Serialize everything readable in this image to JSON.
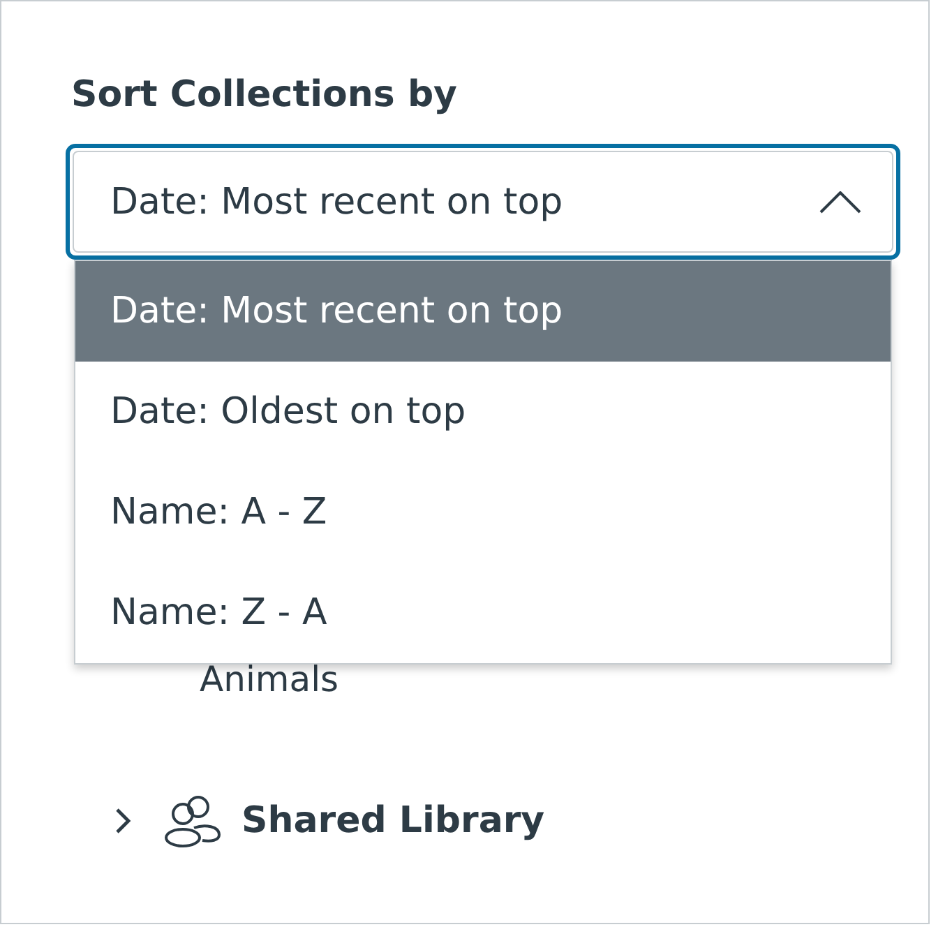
{
  "label": "Sort Collections by",
  "select": {
    "value": "Date: Most recent on top",
    "expanded": true
  },
  "options": [
    {
      "label": "Date: Most recent on top",
      "selected": true
    },
    {
      "label": "Date: Oldest on top",
      "selected": false
    },
    {
      "label": "Name: A - Z",
      "selected": false
    },
    {
      "label": "Name: Z - A",
      "selected": false
    }
  ],
  "tree": [
    {
      "kind": "item",
      "label": "Animals"
    },
    {
      "kind": "group",
      "label": "Shared Library",
      "expanded": false
    }
  ]
}
